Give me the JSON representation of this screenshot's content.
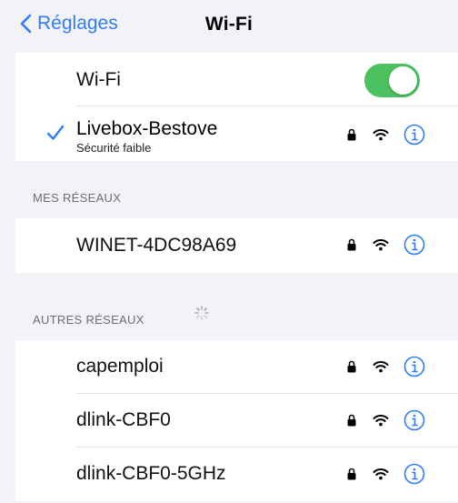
{
  "nav": {
    "back_label": "Réglages",
    "title": "Wi-Fi"
  },
  "wifi_toggle": {
    "label": "Wi-Fi",
    "state": "on",
    "color": "#4bc15f"
  },
  "connected": {
    "name": "Livebox-Bestove",
    "subtitle": "Sécurité faible",
    "checkmark_color": "#2f7cf6"
  },
  "sections": {
    "my_networks_header": "MES RÉSEAUX",
    "other_networks_header": "AUTRES RÉSEAUX"
  },
  "my_networks": [
    {
      "name": "WINET-4DC98A69"
    }
  ],
  "other_networks": [
    {
      "name": "capemploi"
    },
    {
      "name": "dlink-CBF0"
    },
    {
      "name": "dlink-CBF0-5GHz"
    }
  ],
  "icons": {
    "back": "chevron-left-icon",
    "check": "checkmark-icon",
    "lock": "lock-icon",
    "wifi": "wifi-signal-icon",
    "info": "info-circle-icon",
    "loading": "activity-spinner-icon"
  },
  "accent_color": "#2f7cf6"
}
